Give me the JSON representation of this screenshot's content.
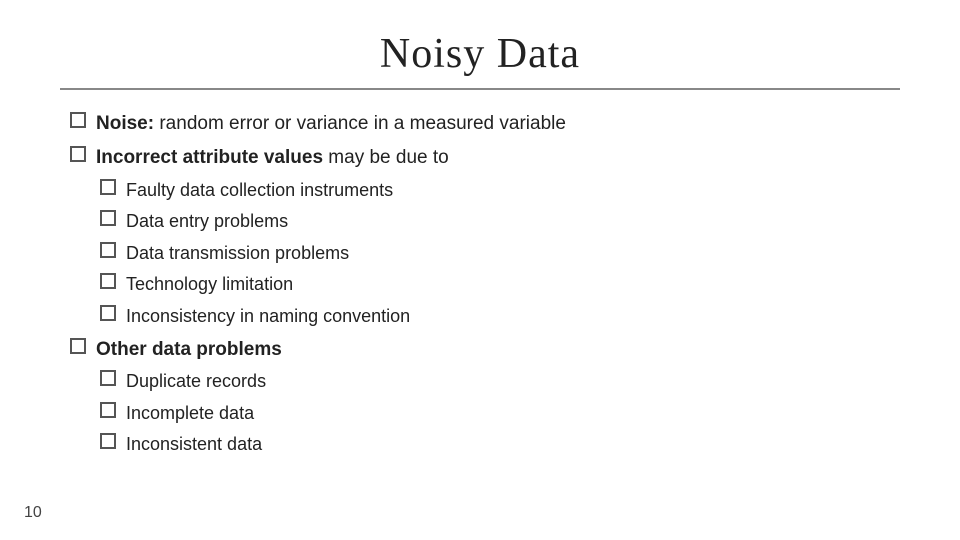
{
  "title": "Noisy Data",
  "pageNumber": "10",
  "items": [
    {
      "id": "noise",
      "text_bold": "Noise:",
      "text_normal": " random error or variance in a measured variable",
      "children": []
    },
    {
      "id": "incorrect",
      "text_bold": "Incorrect attribute values",
      "text_normal": " may be due to",
      "children": [
        {
          "id": "faulty",
          "text": "Faulty data collection instruments"
        },
        {
          "id": "data-entry",
          "text": "Data entry problems"
        },
        {
          "id": "data-transmission",
          "text": "Data transmission problems"
        },
        {
          "id": "technology",
          "text": "Technology limitation"
        },
        {
          "id": "inconsistency",
          "text": "Inconsistency in naming convention"
        }
      ]
    },
    {
      "id": "other",
      "text_bold": "Other data problems",
      "text_normal": "",
      "children": [
        {
          "id": "duplicate",
          "text": "Duplicate records"
        },
        {
          "id": "incomplete",
          "text": "Incomplete data"
        },
        {
          "id": "inconsistent",
          "text": "Inconsistent data"
        }
      ]
    }
  ]
}
